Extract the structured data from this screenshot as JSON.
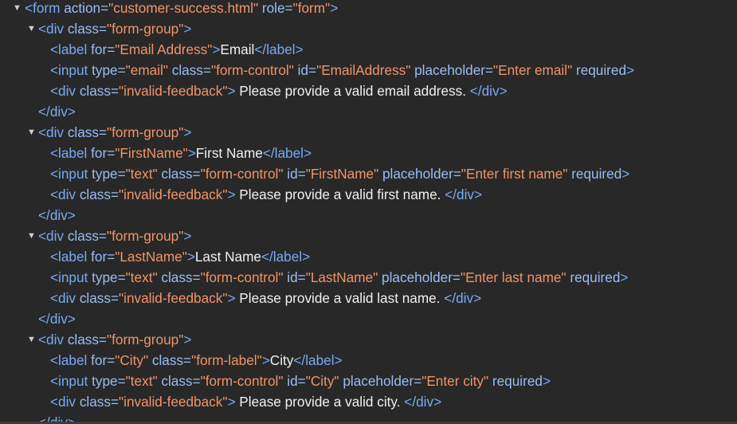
{
  "lines": [
    {
      "indent": 0,
      "kind": "open",
      "expandable": true,
      "tag": "form",
      "attrs": [
        {
          "n": "action",
          "v": "customer-success.html"
        },
        {
          "n": "role",
          "v": "form"
        }
      ]
    },
    {
      "indent": 1,
      "kind": "open",
      "expandable": true,
      "tag": "div",
      "attrs": [
        {
          "n": "class",
          "v": "form-group"
        }
      ]
    },
    {
      "indent": 2,
      "kind": "elem",
      "tag": "label",
      "attrs": [
        {
          "n": "for",
          "v": "Email Address"
        }
      ],
      "text": "Email"
    },
    {
      "indent": 2,
      "kind": "open",
      "tag": "input",
      "attrs": [
        {
          "n": "type",
          "v": "email"
        },
        {
          "n": "class",
          "v": "form-control"
        },
        {
          "n": "id",
          "v": "EmailAddress"
        },
        {
          "n": "placeholder",
          "v": "Enter email"
        },
        {
          "n": "required"
        }
      ]
    },
    {
      "indent": 2,
      "kind": "elem",
      "tag": "div",
      "attrs": [
        {
          "n": "class",
          "v": "invalid-feedback"
        }
      ],
      "text": " Please provide a valid email address. "
    },
    {
      "indent": 1,
      "kind": "close",
      "tag": "div"
    },
    {
      "indent": 1,
      "kind": "open",
      "expandable": true,
      "tag": "div",
      "attrs": [
        {
          "n": "class",
          "v": "form-group"
        }
      ]
    },
    {
      "indent": 2,
      "kind": "elem",
      "tag": "label",
      "attrs": [
        {
          "n": "for",
          "v": "FirstName"
        }
      ],
      "text": "First Name"
    },
    {
      "indent": 2,
      "kind": "open",
      "tag": "input",
      "attrs": [
        {
          "n": "type",
          "v": "text"
        },
        {
          "n": "class",
          "v": "form-control"
        },
        {
          "n": "id",
          "v": "FirstName"
        },
        {
          "n": "placeholder",
          "v": "Enter first name"
        },
        {
          "n": "required"
        }
      ]
    },
    {
      "indent": 2,
      "kind": "elem",
      "tag": "div",
      "attrs": [
        {
          "n": "class",
          "v": "invalid-feedback"
        }
      ],
      "text": " Please provide a valid first name. "
    },
    {
      "indent": 1,
      "kind": "close",
      "tag": "div"
    },
    {
      "indent": 1,
      "kind": "open",
      "expandable": true,
      "tag": "div",
      "attrs": [
        {
          "n": "class",
          "v": "form-group"
        }
      ]
    },
    {
      "indent": 2,
      "kind": "elem",
      "tag": "label",
      "attrs": [
        {
          "n": "for",
          "v": "LastName"
        }
      ],
      "text": "Last Name"
    },
    {
      "indent": 2,
      "kind": "open",
      "tag": "input",
      "attrs": [
        {
          "n": "type",
          "v": "text"
        },
        {
          "n": "class",
          "v": "form-control"
        },
        {
          "n": "id",
          "v": "LastName"
        },
        {
          "n": "placeholder",
          "v": "Enter last name"
        },
        {
          "n": "required"
        }
      ]
    },
    {
      "indent": 2,
      "kind": "elem",
      "tag": "div",
      "attrs": [
        {
          "n": "class",
          "v": "invalid-feedback"
        }
      ],
      "text": " Please provide a valid last name. "
    },
    {
      "indent": 1,
      "kind": "close",
      "tag": "div"
    },
    {
      "indent": 1,
      "kind": "open",
      "expandable": true,
      "tag": "div",
      "attrs": [
        {
          "n": "class",
          "v": "form-group"
        }
      ]
    },
    {
      "indent": 2,
      "kind": "elem",
      "tag": "label",
      "attrs": [
        {
          "n": "for",
          "v": "City"
        },
        {
          "n": "class",
          "v": "form-label"
        }
      ],
      "text": "City"
    },
    {
      "indent": 2,
      "kind": "open",
      "tag": "input",
      "attrs": [
        {
          "n": "type",
          "v": "text"
        },
        {
          "n": "class",
          "v": "form-control"
        },
        {
          "n": "id",
          "v": "City"
        },
        {
          "n": "placeholder",
          "v": "Enter city"
        },
        {
          "n": "required"
        }
      ]
    },
    {
      "indent": 2,
      "kind": "elem",
      "tag": "div",
      "attrs": [
        {
          "n": "class",
          "v": "invalid-feedback"
        }
      ],
      "text": " Please provide a valid city. "
    },
    {
      "indent": 1,
      "kind": "close",
      "tag": "div"
    }
  ]
}
